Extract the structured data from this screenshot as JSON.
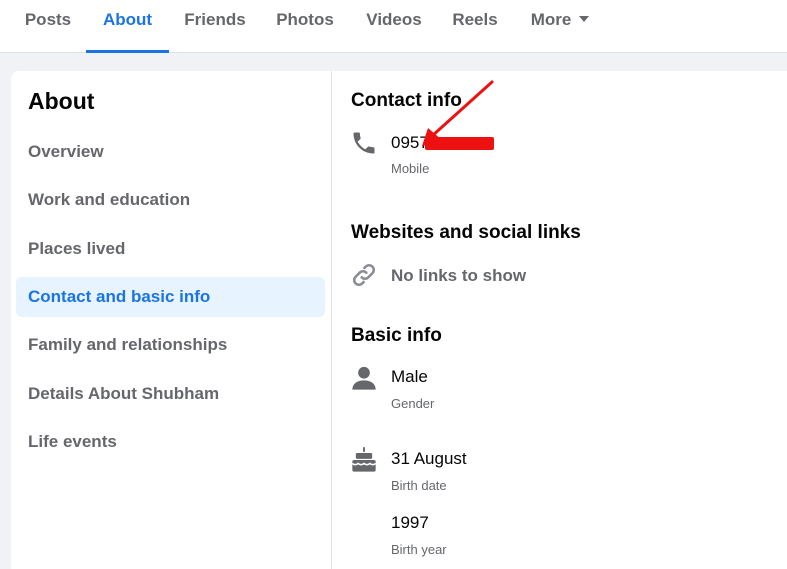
{
  "tabs": [
    {
      "label": "Posts"
    },
    {
      "label": "About"
    },
    {
      "label": "Friends"
    },
    {
      "label": "Photos"
    },
    {
      "label": "Videos"
    },
    {
      "label": "Reels"
    },
    {
      "label": "More"
    }
  ],
  "active_tab": "About",
  "sidebar": {
    "title": "About",
    "items": [
      {
        "label": "Overview"
      },
      {
        "label": "Work and education"
      },
      {
        "label": "Places lived"
      },
      {
        "label": "Contact and basic info"
      },
      {
        "label": "Family and relationships"
      },
      {
        "label": "Details About Shubham"
      },
      {
        "label": "Life events"
      }
    ],
    "active_item": "Contact and basic info"
  },
  "contact": {
    "title": "Contact info",
    "phone_visible": "0957",
    "phone_type": "Mobile",
    "phone_icon": "phone-icon"
  },
  "websites": {
    "title": "Websites and social links",
    "empty_text": "No links to show",
    "icon": "link-icon"
  },
  "basic": {
    "title": "Basic info",
    "gender": {
      "value": "Male",
      "label": "Gender",
      "icon": "person-icon"
    },
    "birth_date": {
      "value": "31 August",
      "label": "Birth date",
      "icon": "cake-icon"
    },
    "birth_year": {
      "value": "1997",
      "label": "Birth year"
    }
  },
  "colors": {
    "accent": "#1b74e4",
    "active_bg": "#e7f3ff",
    "muted_text": "#65676b",
    "annotation": "#ee1111"
  }
}
